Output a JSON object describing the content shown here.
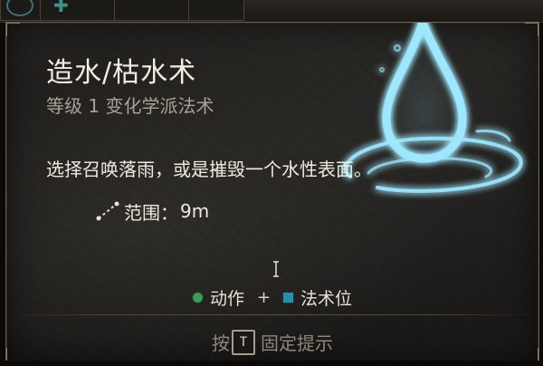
{
  "tooltip": {
    "title": "造水/枯水术",
    "subtitle": "等级 1 变化学派法术",
    "description": "选择召唤落雨，或是摧毁一个水性表面。",
    "range": {
      "label": "范围：",
      "value": "9m",
      "icon": "range-icon"
    },
    "cost": {
      "action_label": "动作",
      "plus": "+",
      "slot_label": "法术位",
      "action_color": "#3f9a55",
      "slot_color": "#2a8ea6"
    },
    "footer": {
      "prefix": "按",
      "key": "T",
      "suffix": "固定提示"
    }
  },
  "colors": {
    "panel_bg": "#1d1c1a",
    "border": "#6a5e4c",
    "spell_glow": "#9fe7ff"
  }
}
